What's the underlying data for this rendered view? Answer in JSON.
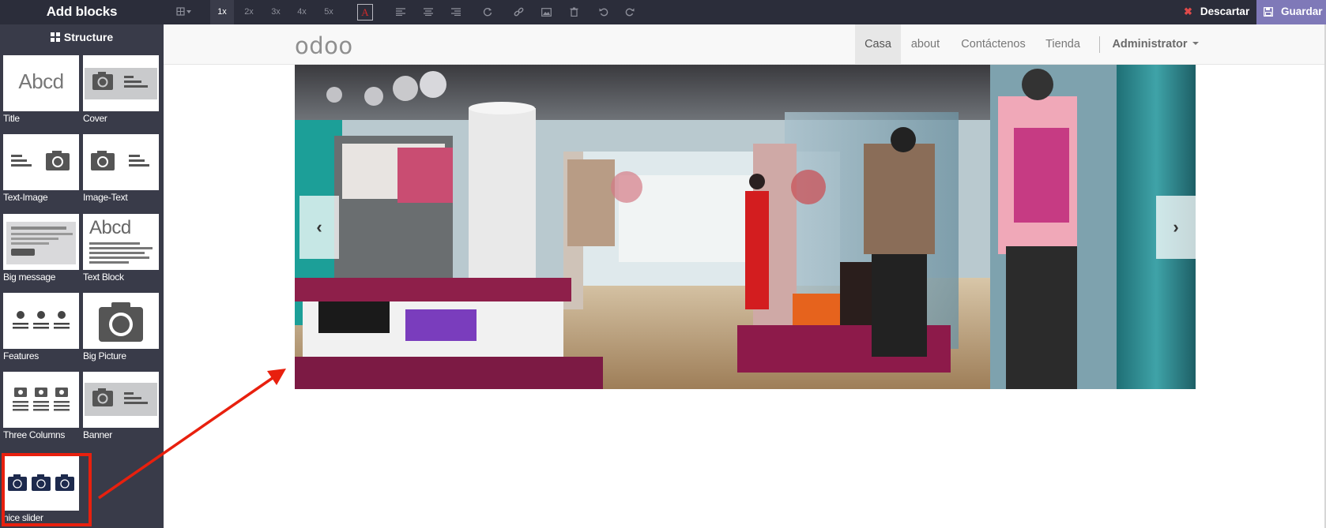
{
  "editor": {
    "title": "Add blocks",
    "toolbar": {
      "zoom_levels": [
        "1x",
        "2x",
        "3x",
        "4x",
        "5x"
      ],
      "active_zoom": "1x",
      "discard_label": "Descartar",
      "save_label": "Guardar"
    },
    "sidebar": {
      "heading": "Structure",
      "blocks": [
        {
          "label": "Title",
          "thumb_text": "Abcd"
        },
        {
          "label": "Cover"
        },
        {
          "label": "Text-Image"
        },
        {
          "label": "Image-Text"
        },
        {
          "label": "Big message"
        },
        {
          "label": "Text Block",
          "thumb_text": "Abcd"
        },
        {
          "label": "Features"
        },
        {
          "label": "Big Picture"
        },
        {
          "label": "Three Columns"
        },
        {
          "label": "Banner"
        },
        {
          "label": "nice slider"
        }
      ]
    }
  },
  "website": {
    "logo": "odoo",
    "nav": [
      "Casa",
      "about",
      "Contáctenos",
      "Tienda"
    ],
    "active_nav": "Casa",
    "user": "Administrator"
  },
  "colors": {
    "toolbar_bg": "#2b2d3a",
    "sidebar_bg": "#393b49",
    "save_bg": "#7f79b8",
    "discard_icon": "#e04a4a",
    "highlight_red": "#e8200e",
    "logo_accent": "#a24689"
  }
}
